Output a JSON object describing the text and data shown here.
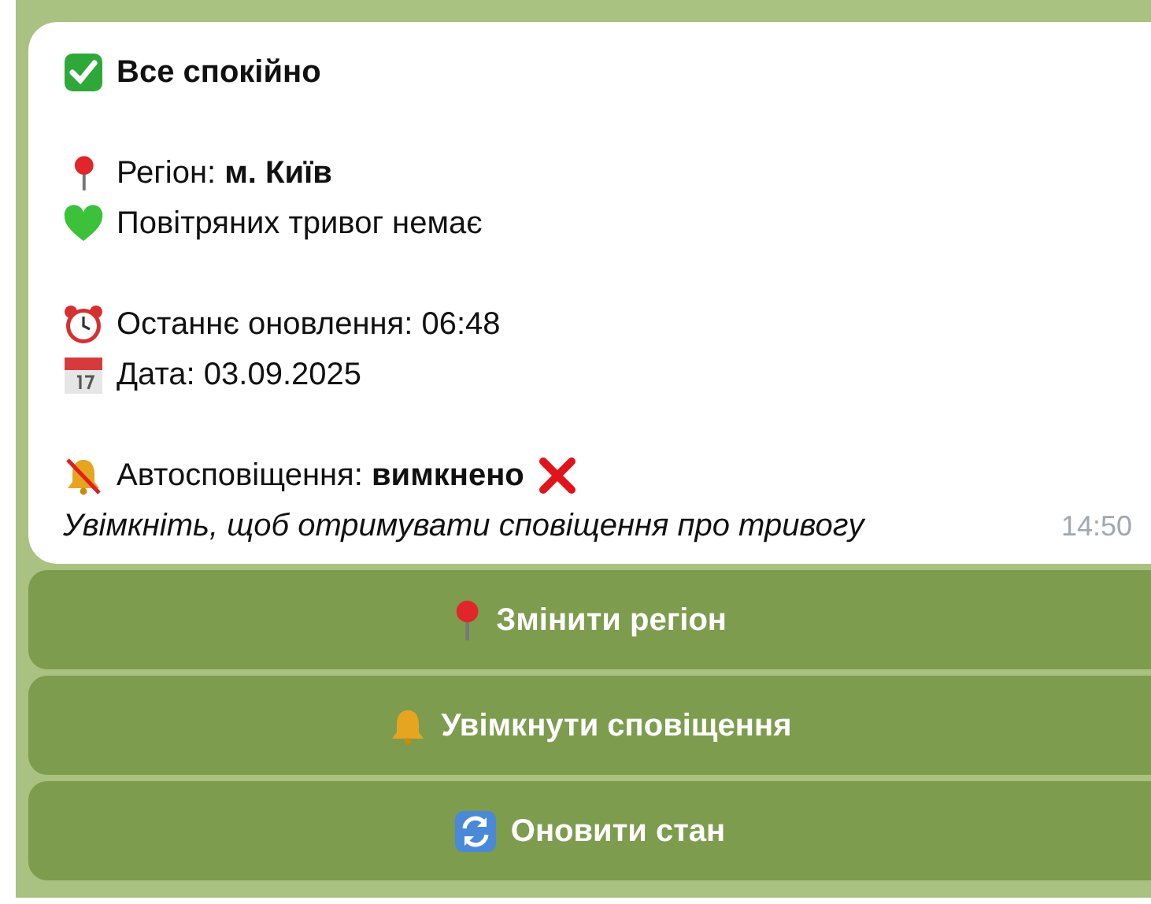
{
  "message": {
    "title": "Все спокійно",
    "blocks": [
      [
        {
          "kind": "pin",
          "text": "Регіон: **м. Київ**"
        },
        {
          "kind": "heart",
          "text": "Повітряних тривог немає"
        }
      ],
      [
        {
          "kind": "clock",
          "text": "Останнє оновлення: 06:48"
        },
        {
          "kind": "calendar",
          "text": "Дата: 03.09.2025"
        }
      ],
      [
        {
          "kind": "bell-off",
          "text": "Автосповіщення: **вимкнено**"
        },
        {
          "kind": "note",
          "text": "Увімкніть, щоб отримувати сповіщення про тривогу"
        }
      ]
    ],
    "time": "14:50"
  },
  "buttons": [
    {
      "kind": "pin",
      "label": "Змінити регіон"
    },
    {
      "kind": "bell",
      "label": "Увімкнути сповіщення"
    },
    {
      "kind": "refresh",
      "label": "Оновити стан"
    }
  ]
}
